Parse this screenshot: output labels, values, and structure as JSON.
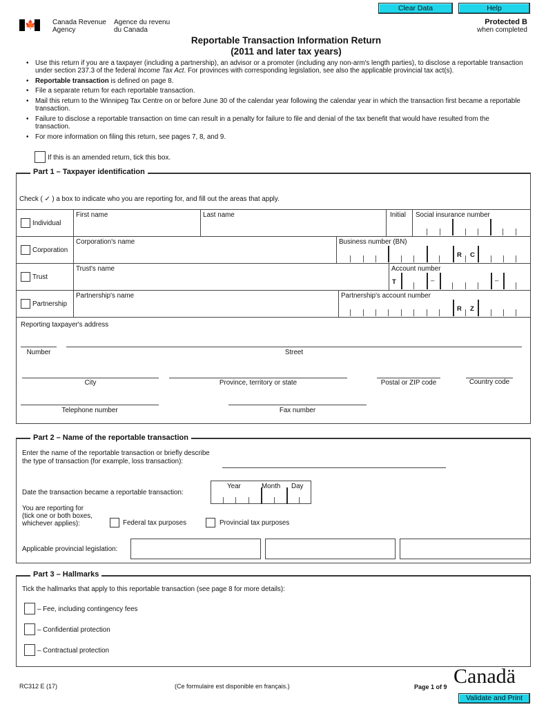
{
  "toolbar": {
    "clear_label": "Clear Data",
    "help_label": "Help",
    "validate_label": "Validate and Print",
    "button_color": "#1fd5ea"
  },
  "header": {
    "agency_en_1": "Canada Revenue",
    "agency_en_2": "Agency",
    "agency_fr_1": "Agence du revenu",
    "agency_fr_2": "du Canada",
    "title_line1": "Reportable Transaction Information Return",
    "title_line2": "(2011 and later tax years)",
    "protected": "Protected B",
    "protected_sub": "when completed",
    "flag_icon": "maple-leaf"
  },
  "intro": {
    "bullet1_a": "Use this return if you are a taxpayer (including a partnership), an advisor or a promoter (including any non-arm's length parties), to disclose a reportable transaction under section 237.3 of the federal ",
    "bullet1_italic": "Income Tax Act",
    "bullet1_b": ". For provinces with corresponding legislation, see also the applicable provincial tax act(s).",
    "bullet2_bold": "Reportable transaction",
    "bullet2_rest": " is defined on page 8.",
    "bullet3": "File a separate return for each reportable transaction.",
    "bullet4": "Mail this return to the Winnipeg Tax Centre on or before June 30 of the calendar year following the calendar year in which the transaction first became a reportable transaction.",
    "bullet5": "Failure to disclose a reportable transaction on time can result in a penalty for failure to file and denial of the tax benefit that would have resulted from the transaction.",
    "bullet6": "For more information on filing this return, see pages 7, 8, and 9.",
    "amended_label": "If this is an amended return, tick this box."
  },
  "part1": {
    "title": "Part 1 – Taxpayer identification",
    "instruction": "Check ( ✓ ) a box to indicate who you are reporting for, and fill out the areas that apply.",
    "individual": "Individual",
    "first_name": "First name",
    "last_name": "Last name",
    "initial": "Initial",
    "sin": "Social insurance number",
    "corporation": "Corporation",
    "corp_name": "Corporation's name",
    "bn": "Business number (BN)",
    "bn_r": "R",
    "bn_c": "C",
    "trust": "Trust",
    "trust_name": "Trust's name",
    "account_number": "Account number",
    "acct_t": "T",
    "dash": "–",
    "partnership": "Partnership",
    "partnership_name": "Partnership's name",
    "partnership_acct": "Partnership's account number",
    "pa_r": "R",
    "pa_z": "Z",
    "address_label": "Reporting taxpayer's address",
    "number": "Number",
    "street": "Street",
    "city": "City",
    "province": "Province, territory or state",
    "postal": "Postal or ZIP code",
    "country": "Country code",
    "telephone": "Telephone number",
    "fax": "Fax number"
  },
  "part2": {
    "title": "Part 2 – Name of the reportable transaction",
    "name_line1": "Enter the name of the reportable transaction or briefly describe",
    "name_line2": "the type of transaction (for example, loss transaction):",
    "date_label": "Date the transaction became a reportable transaction:",
    "year": "Year",
    "month": "Month",
    "day": "Day",
    "reporting_1": "You are reporting for",
    "reporting_2": "(tick one or both boxes,",
    "reporting_3": "whichever applies):",
    "federal": "Federal tax purposes",
    "provincial": "Provincial tax purposes",
    "legislation": "Applicable provincial legislation:"
  },
  "part3": {
    "title": "Part 3 – Hallmarks",
    "instruction": "Tick the hallmarks that apply to this reportable transaction (see page 8 for more details):",
    "items": [
      "–  Fee, including contingency fees",
      "–  Confidential protection",
      "–  Contractual protection"
    ]
  },
  "footer": {
    "form_id": "RC312 E (17)",
    "french": "(Ce formulaire est disponible en français.)",
    "page": "Page 1 of 9",
    "wordmark": "Canadä"
  }
}
